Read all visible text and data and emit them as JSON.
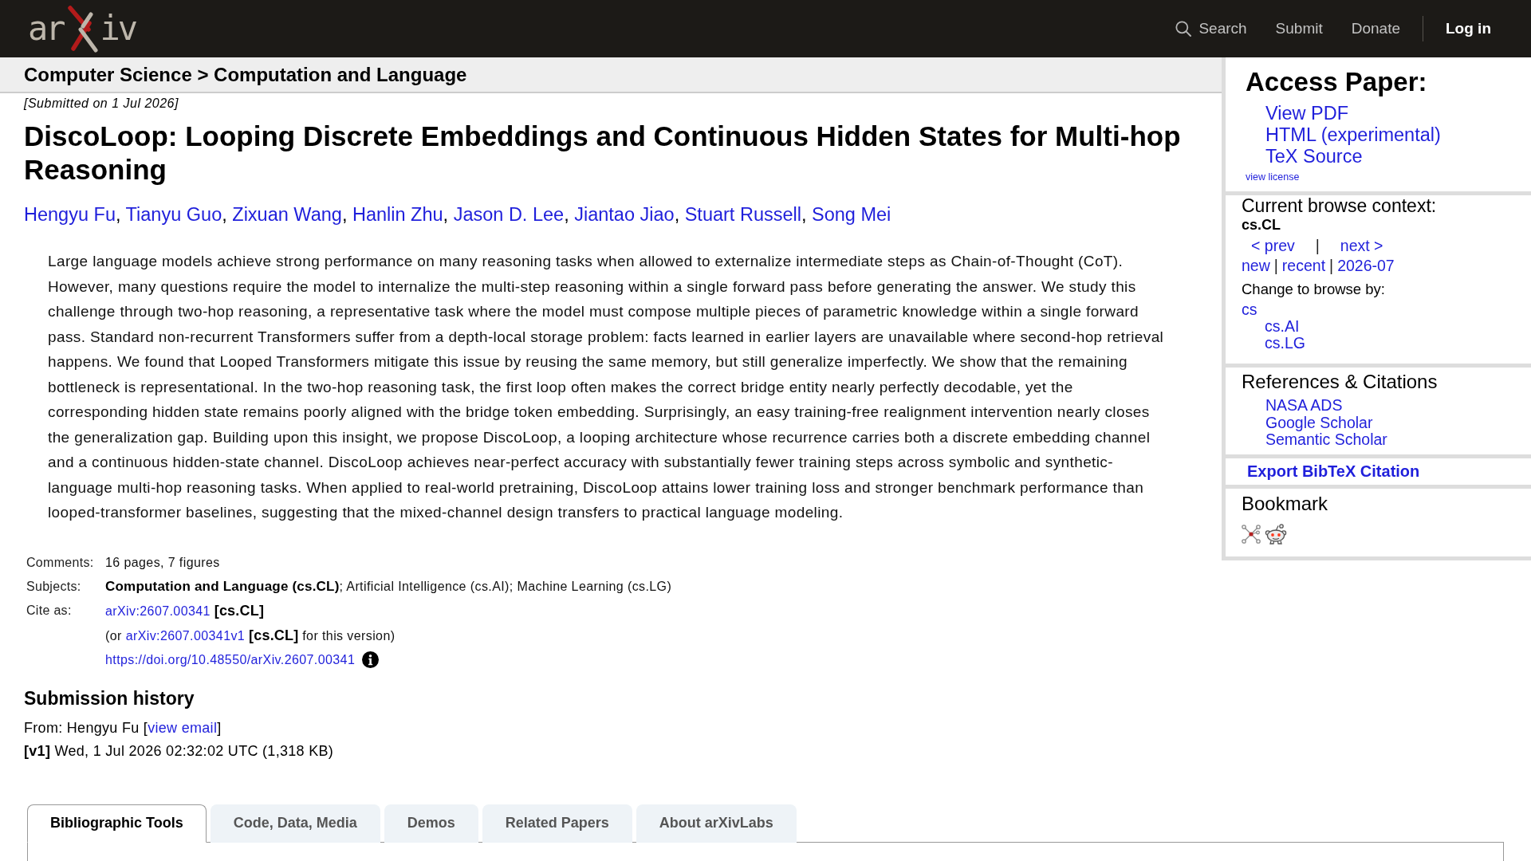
{
  "header": {
    "logo": {
      "before_x": "ar",
      "after_x": "iv"
    },
    "nav": [
      {
        "kind": "search",
        "label": "Search"
      },
      {
        "kind": "link",
        "label": "Submit"
      },
      {
        "kind": "link",
        "label": "Donate"
      },
      {
        "kind": "login",
        "label": "Log in"
      }
    ]
  },
  "breadcrumb": "Computer Science > Computation and Language",
  "dateline": "[Submitted on 1 Jul 2026]",
  "title": "DiscoLoop: Looping Discrete Embeddings and Continuous Hidden States for Multi-hop Reasoning",
  "authors": {
    "names": [
      "Hengyu Fu",
      "Tianyu Guo",
      "Zixuan Wang",
      "Hanlin Zhu",
      "Jason D. Lee",
      "Jiantao Jiao",
      "Stuart Russell",
      "Song Mei"
    ],
    "separator": ","
  },
  "abstract": "Large language models achieve strong performance on many reasoning tasks when allowed to externalize intermediate steps as Chain-of-Thought (CoT). However, many questions require the model to internalize the multi-step reasoning within a single forward pass before generating the answer. We study this challenge through two-hop reasoning, a representative task where the model must compose multiple pieces of parametric knowledge within a single forward pass. Standard non-recurrent Transformers suffer from a depth-local storage problem: facts learned in earlier layers are unavailable where second-hop retrieval happens. We found that Looped Transformers mitigate this issue by reusing the same memory, but still generalize imperfectly. We show that the remaining bottleneck is representational. In the two-hop reasoning task, the first loop often makes the correct bridge entity nearly perfectly decodable, yet the corresponding hidden state remains poorly aligned with the bridge token embedding. Surprisingly, an easy training-free realignment intervention nearly closes the generalization gap. Building upon this insight, we propose DiscoLoop, a looping architecture whose recurrence carries both a discrete embedding channel and a continuous hidden-state channel. DiscoLoop achieves near-perfect accuracy with substantially fewer training steps across symbolic and synthetic-language multi-hop reasoning tasks. When applied to real-world pretraining, DiscoLoop attains lower training loss and stronger benchmark performance than looped-transformer baselines, suggesting that the mixed-channel design transfers to practical language modeling.",
  "metadata": [
    {
      "kind": "text",
      "label": "Comments:",
      "value": "16 pages, 7 figures"
    },
    {
      "kind": "text",
      "label": "Subjects:",
      "value": "**Computation and Language (cs.CL)**; Artificial Intelligence (cs.AI); Machine Learning (cs.LG)"
    },
    {
      "kind": "cite",
      "label": "Cite as:",
      "lines": [
        {
          "kind": "citation",
          "link": "arXiv:2607.00341",
          "suffix": "**[cs.CL]**"
        },
        {
          "kind": "citation",
          "prefix": "(or",
          "link": "arXiv:2607.00341v1",
          "suffix": "**[cs.CL]** for this version)"
        },
        {
          "kind": "doi",
          "link": "https://doi.org/10.48550/arXiv.2607.00341"
        }
      ]
    }
  ],
  "submission_history": {
    "title": "Submission history",
    "from": {
      "prefix": "From: Hengyu Fu [",
      "link": "view email",
      "suffix": "]"
    },
    "versions": [
      "**[v1]** Wed, 1 Jul 2026 02:32:02 UTC (1,318 KB)"
    ]
  },
  "sidebar": {
    "access_paper": {
      "title": "Access Paper:",
      "links": [
        "View PDF",
        "HTML (experimental)",
        "TeX Source"
      ],
      "license": "view license"
    },
    "browse": {
      "title": "Current browse context:",
      "context": "cs.CL",
      "prev": "< prev",
      "divider": "|",
      "next": "next >",
      "listings": [
        "new",
        "recent",
        "2026-07"
      ],
      "listing_separator": "|",
      "change_label": "Change to browse by:",
      "categories": [
        {
          "label": "cs",
          "children": [
            {
              "label": "cs.AI"
            },
            {
              "label": "cs.LG"
            }
          ]
        }
      ]
    },
    "references": {
      "title": "References & Citations",
      "links": [
        "NASA ADS",
        "Google Scholar",
        "Semantic Scholar"
      ]
    },
    "export": {
      "label": "Export BibTeX Citation"
    },
    "bookmark": {
      "title": "Bookmark"
    }
  },
  "tabs": [
    {
      "label": "Bibliographic Tools",
      "selected": true
    },
    {
      "label": "Code, Data, Media",
      "selected": false
    },
    {
      "label": "Demos",
      "selected": false
    },
    {
      "label": "Related Papers",
      "selected": false
    },
    {
      "label": "About arXivLabs",
      "selected": false
    }
  ]
}
